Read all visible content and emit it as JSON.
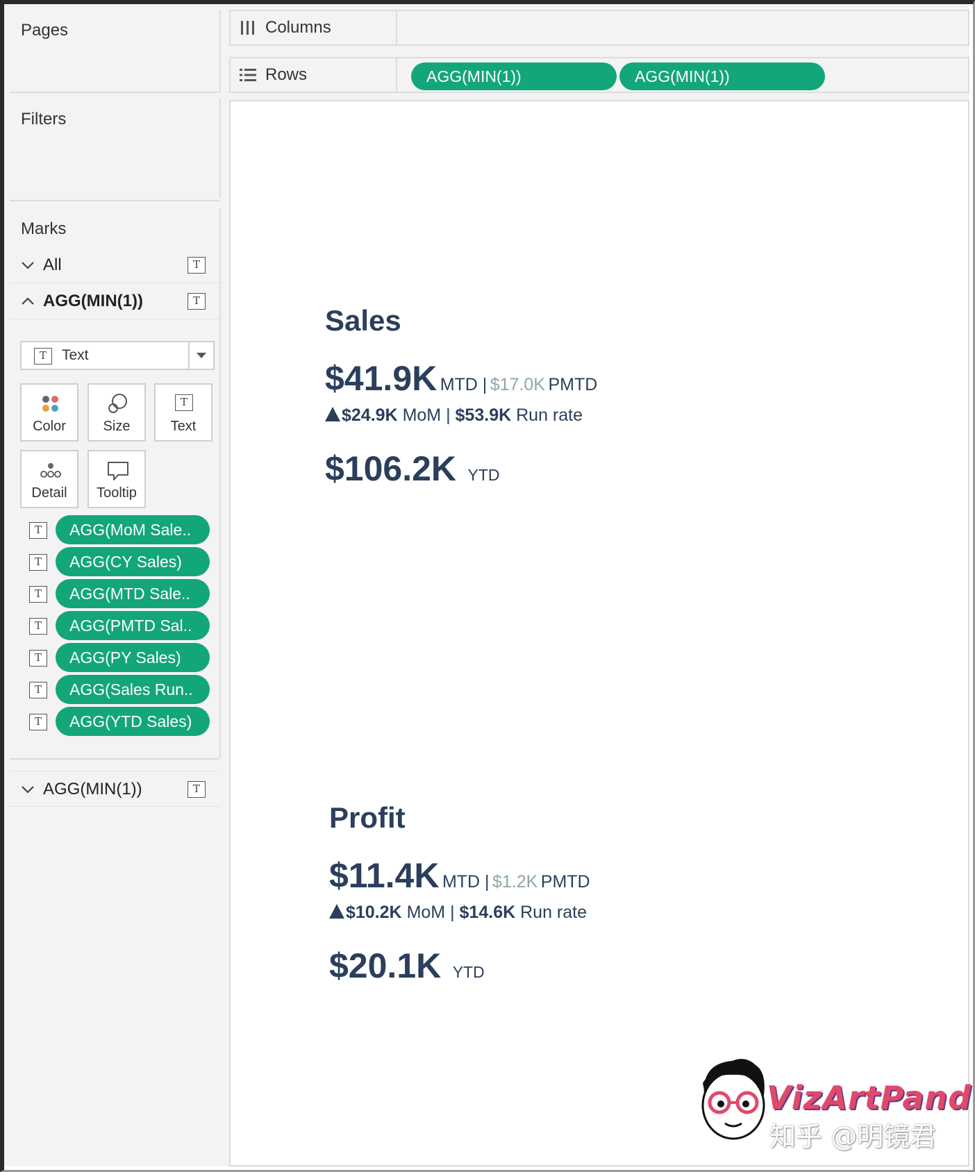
{
  "panes": {
    "pages": "Pages",
    "filters": "Filters",
    "marks": "Marks"
  },
  "marks": {
    "all_label": "All",
    "group1_label": "AGG(MIN(1))",
    "group2_label": "AGG(MIN(1))",
    "mark_type": "Text",
    "cards": {
      "color": "Color",
      "size": "Size",
      "text": "Text",
      "detail": "Detail",
      "tooltip": "Tooltip"
    },
    "pills": [
      "AGG(MoM Sale..",
      "AGG(CY Sales)",
      "AGG(MTD Sale..",
      "AGG(PMTD Sal..",
      "AGG(PY Sales)",
      "AGG(Sales Run..",
      "AGG(YTD Sales)"
    ],
    "t_glyph": "T"
  },
  "shelves": {
    "columns_label": "Columns",
    "rows_label": "Rows",
    "rows_pills": [
      "AGG(MIN(1))",
      "AGG(MIN(1))"
    ]
  },
  "kpis": {
    "sales": {
      "title": "Sales",
      "mtd": "$41.9K",
      "mtd_unit": "MTD |",
      "pmtd": "$17.0K",
      "pmtd_unit": "PMTD",
      "mom": "$24.9K",
      "mom_unit": "MoM |",
      "run": "$53.9K",
      "run_unit": "Run rate",
      "ytd": "$106.2K",
      "ytd_unit": "YTD"
    },
    "profit": {
      "title": "Profit",
      "mtd": "$11.4K",
      "mtd_unit": "MTD |",
      "pmtd": "$1.2K",
      "pmtd_unit": "PMTD",
      "mom": "$10.2K",
      "mom_unit": "MoM |",
      "run": "$14.6K",
      "run_unit": "Run rate",
      "ytd": "$20.1K",
      "ytd_unit": "YTD"
    }
  },
  "watermark": {
    "brand": "VizArtPandey",
    "cn": "知乎 @明镜君"
  },
  "colors": {
    "pill_green": "#13a67a",
    "kpi_navy": "#2b3f5c",
    "kpi_muted": "#8fa8a6"
  }
}
